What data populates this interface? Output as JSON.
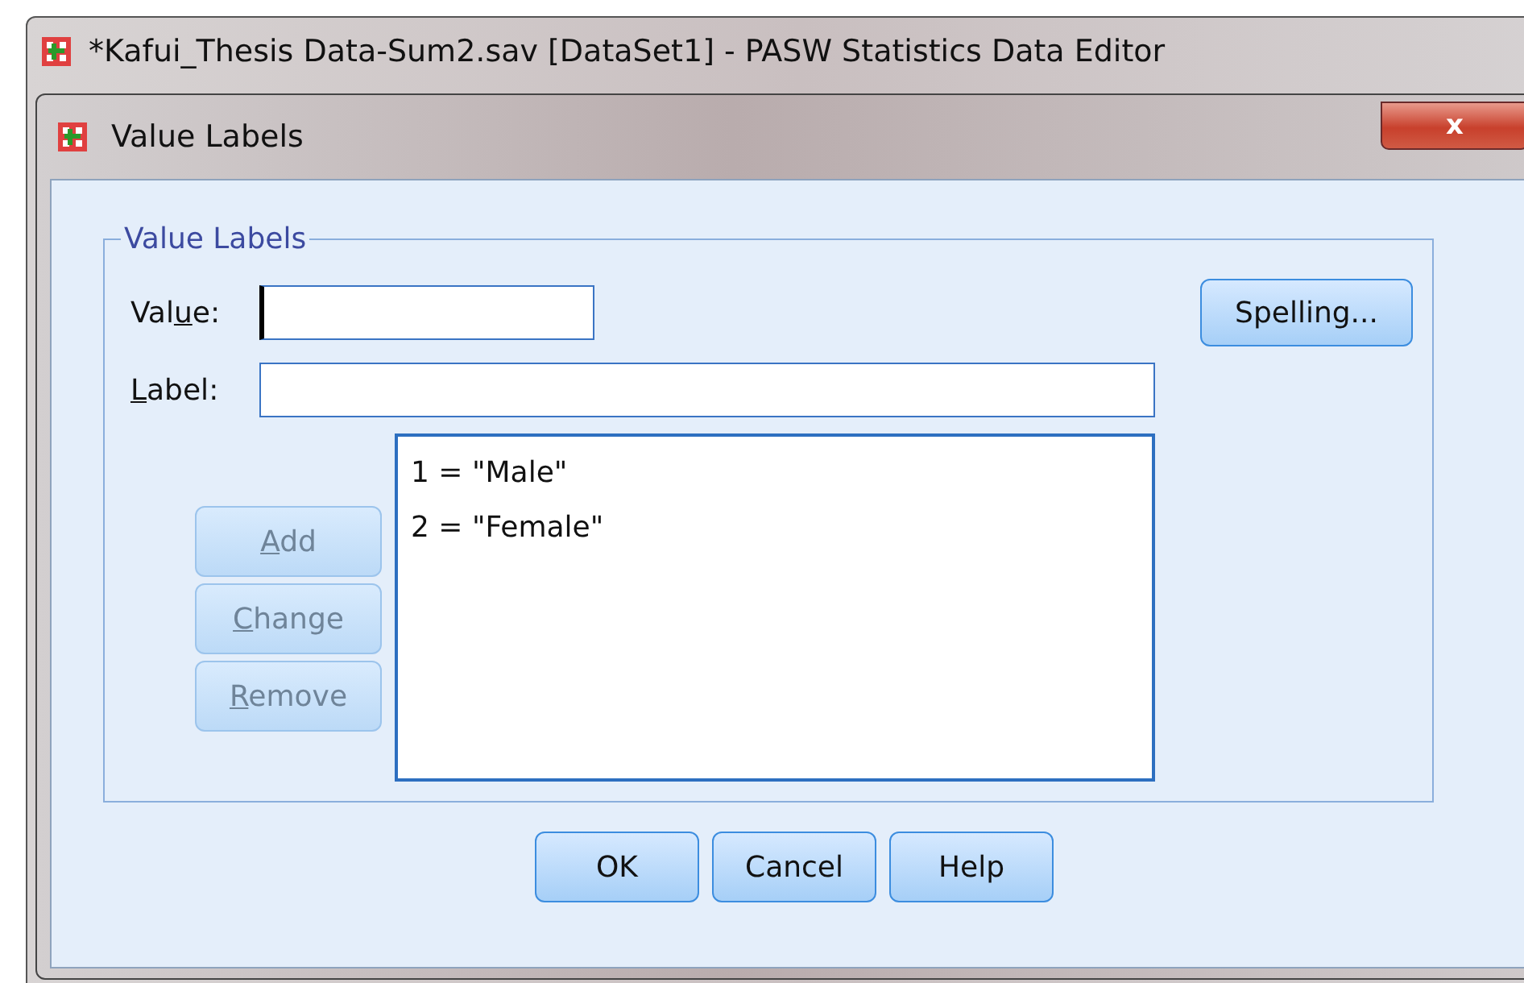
{
  "main_window": {
    "title": "*Kafui_Thesis Data-Sum2.sav [DataSet1] - PASW Statistics Data Editor"
  },
  "dialog": {
    "title": "Value Labels",
    "close": "x"
  },
  "group": {
    "title": "Value Labels"
  },
  "value_field": {
    "label": [
      {
        "text": "Val",
        "underline": false
      },
      {
        "text": "u",
        "underline": true
      },
      {
        "text": "e:",
        "underline": false
      }
    ],
    "focused": true
  },
  "label_field": {
    "label": [
      {
        "text": "L",
        "underline": true
      },
      {
        "text": "abel:",
        "underline": false
      }
    ],
    "focused": false
  },
  "spelling_button": {
    "label": [
      {
        "text": "Spelling...",
        "underline": false
      }
    ],
    "disabled": false
  },
  "side_buttons": [
    {
      "label": [
        {
          "text": "A",
          "underline": true
        },
        {
          "text": "dd",
          "underline": false
        }
      ],
      "disabled": true
    },
    {
      "label": [
        {
          "text": "C",
          "underline": true
        },
        {
          "text": "hange",
          "underline": false
        }
      ],
      "disabled": true
    },
    {
      "label": [
        {
          "text": "R",
          "underline": true
        },
        {
          "text": "emove",
          "underline": false
        }
      ],
      "disabled": true
    }
  ],
  "list": [
    "1 = \"Male\"",
    "2 = \"Female\""
  ],
  "buttons": [
    {
      "label": [
        {
          "text": "OK",
          "underline": false
        }
      ],
      "disabled": false
    },
    {
      "label": [
        {
          "text": "Cancel",
          "underline": false
        }
      ],
      "disabled": false
    },
    {
      "label": [
        {
          "text": "Help",
          "underline": false
        }
      ],
      "disabled": false
    }
  ]
}
